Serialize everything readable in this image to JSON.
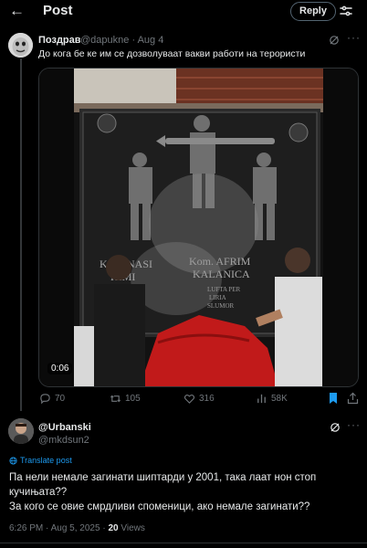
{
  "header": {
    "title": "Post",
    "reply_label": "Reply"
  },
  "parent": {
    "name": "Поздрав",
    "handle": "@dapukne",
    "date": "Aug 4",
    "text": "До кога бе ке им се дозволуваат вакви работи на терористи",
    "video": {
      "time": "0:06",
      "plaque_left": "Kom. NASI\nHIMI",
      "plaque_right": "Kom. AFRIM\nKALANICA",
      "plaque_small": "LUFTA PER\nLIRIA\nSLUMOR"
    },
    "stats": {
      "replies": "70",
      "reposts": "105",
      "likes": "316",
      "views": "58K"
    }
  },
  "main": {
    "name": "@Urbanski",
    "handle": "@mkdsun2",
    "translate_label": "Translate post",
    "text_line1": "Па нели немале загинати шиптарди у 2001, така лаат нон стоп кучињата??",
    "text_line2": "За кого се овие смрдливи споменици, ако немале загинати??",
    "time": "6:26 PM",
    "date": "Aug 5, 2025",
    "views_count": "20",
    "views_label": "Views"
  },
  "colors": {
    "background": "#000000",
    "text_primary": "#e7e9ea",
    "text_secondary": "#71767b",
    "accent": "#1d9bf0",
    "bookmark_active": "#1d9bf0"
  },
  "icons": [
    "back-arrow-icon",
    "settings-icon",
    "grok-icon",
    "more-icon",
    "reply-icon",
    "repost-icon",
    "like-icon",
    "views-icon",
    "bookmark-icon",
    "share-icon",
    "translate-icon"
  ]
}
